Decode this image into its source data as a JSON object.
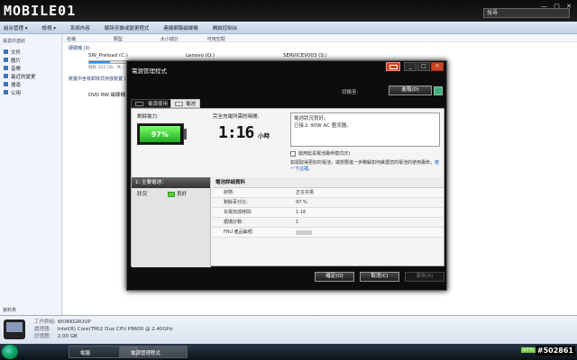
{
  "banner": {
    "logo": "MOBILE01",
    "search_placeholder": "搜尋",
    "controls": [
      "—",
      "□",
      "✕"
    ]
  },
  "toolbar": {
    "items": [
      "組合管理 ▾",
      "檢視 ▾",
      "系統內容",
      "解除安裝或變更程式",
      "連線網路磁碟機",
      "開啟控制台"
    ]
  },
  "sidebar": {
    "header": "最愛的連結",
    "items": [
      "文件",
      "圖片",
      "音樂",
      "最近的變更",
      "搜尋",
      "公用"
    ],
    "footer": "資料夾"
  },
  "explorer": {
    "columns": [
      "名稱",
      "類型",
      "大小總計",
      "可用空間"
    ],
    "group_hdd": "硬碟機 (3)",
    "group_removable": "裝置中含有卸除式存放裝置 (1)",
    "drives": [
      {
        "name": "SW_Preload (C:)",
        "size": "剩餘 203 GB，共 ...",
        "fill": 0.3
      },
      {
        "name": "Lenovo (Q:)",
        "size": "",
        "fill": 0.2
      },
      {
        "name": "SERVICEV003 (S:)",
        "size": "",
        "fill": 0.4
      }
    ],
    "dvd": "DVD RW 磁碟機 (D:)"
  },
  "details": {
    "rows": [
      {
        "label": "工作群組:",
        "value": "WORKGROUP"
      },
      {
        "label": "處理器:",
        "value": "Intel(R) Core(TM)2 Duo CPU     P8600  @ 2.40GHz"
      },
      {
        "label": "記憶體:",
        "value": "2.00 GB"
      }
    ]
  },
  "taskbar": {
    "items": [
      "電腦",
      "電源管理程式"
    ],
    "battery_pct": "97%",
    "watermark": "#502861"
  },
  "dialog": {
    "title": "電源管理程式",
    "switch_label": "切換至:",
    "advanced_btn": "進階(D)",
    "tabs": [
      "電源使用",
      "電池"
    ],
    "remaining_label": "剩餘電力:",
    "battery_percent": "97%",
    "battery_level": 0.97,
    "full_charge_label": "完全充電所需的時間:",
    "full_charge_value": "1:16",
    "full_charge_unit": "小時",
    "status_lines": [
      "電池狀況良好。",
      "已接上 90W AC 整流器。"
    ],
    "checkbox": "啟用延長電池壽命模式(E)",
    "note": "如需取得更好的電池，或想要進一步瞭解如何維護您的電池的使用壽命，",
    "note_link": "按一下這裡。",
    "main_battery": {
      "header": "1: 主要電池：",
      "status_label": "狀況",
      "status_value": "良好"
    },
    "details_header": "電池詳細資料",
    "details": [
      {
        "k": "狀態:",
        "v": "正在充電"
      },
      {
        "k": "剩餘百分比:",
        "v": "97 %"
      },
      {
        "k": "充電完成時間:",
        "v": "1:16"
      },
      {
        "k": "循環計數:",
        "v": "1"
      },
      {
        "k": "FRU 產品編號:",
        "v": ""
      }
    ],
    "buttons": {
      "ok": "確定(O)",
      "cancel": "取消(C)",
      "apply": "套用(A)"
    }
  }
}
